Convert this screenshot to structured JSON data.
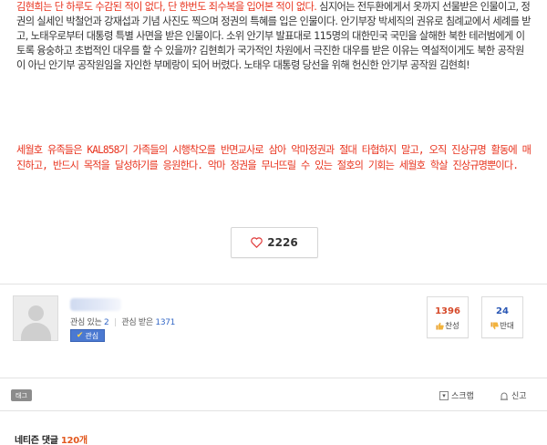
{
  "article": {
    "para1_red": "김현희는 단 하루도 수감된 적이 없다, 단 한번도 죄수복을 입어본 적이 없다.",
    "para1_rest": " 심지어는 전두환에게서 옷까지 선물받은 인물이고, 정권의 실세인 박철언과 강재섭과 기념 사진도 찍으며 정권의 특혜를 입은 인물이다. 안기부장 박세직의 권유로 침례교에서 세례를 받고, 노태우로부터 대통령 특별 사면을 받은 인물이다. 소위 안기부 발표대로 115명의 대한민국 국민을 살해한 북한 테러범에게 이토록 융숭하고 초법적인 대우를 할 수 있을까? 김현희가 국가적인 차원에서 극진한 대우를 받은 이유는 역설적이게도 북한 공작원이 아닌 안기부 공작원임을 자인한 부메랑이 되어 버렸다. 노태우 대통령 당선을 위해 헌신한 안기부 공작원 김현희!",
    "para2": "세월호 유족들은 KAL858기 가족들의 시행착오를 반면교사로 삼아 악마정권과 절대 타협하지 말고, 오직 진상규명 활동에 매진하고, 반드시 목적을 달성하기를 응원한다. 악마 정권을 무너뜨릴 수 있는 절호의 기회는 세월호 학살 진상규명뿐이다."
  },
  "like": {
    "count": "2226",
    "icon": "heart-outline-icon"
  },
  "profile": {
    "stats_interest_label": "관심 있는",
    "stats_interest_value": "2",
    "stats_received_label": "관심 받은",
    "stats_received_value": "1371",
    "fav_button_label": "관심"
  },
  "votes": {
    "up_count": "1396",
    "up_label": "찬성",
    "down_count": "24",
    "down_label": "반대"
  },
  "toolbar": {
    "tag_label": "태그",
    "scrap_label": "스크랩",
    "report_label": "신고"
  },
  "comments": {
    "title": "네티즌 댓글",
    "count": "120개"
  },
  "colors": {
    "accent_red": "#e8331e",
    "link_blue": "#3367c6",
    "up_red": "#d64a2a",
    "down_blue": "#2b58b5",
    "count_orange": "#e2571d"
  }
}
